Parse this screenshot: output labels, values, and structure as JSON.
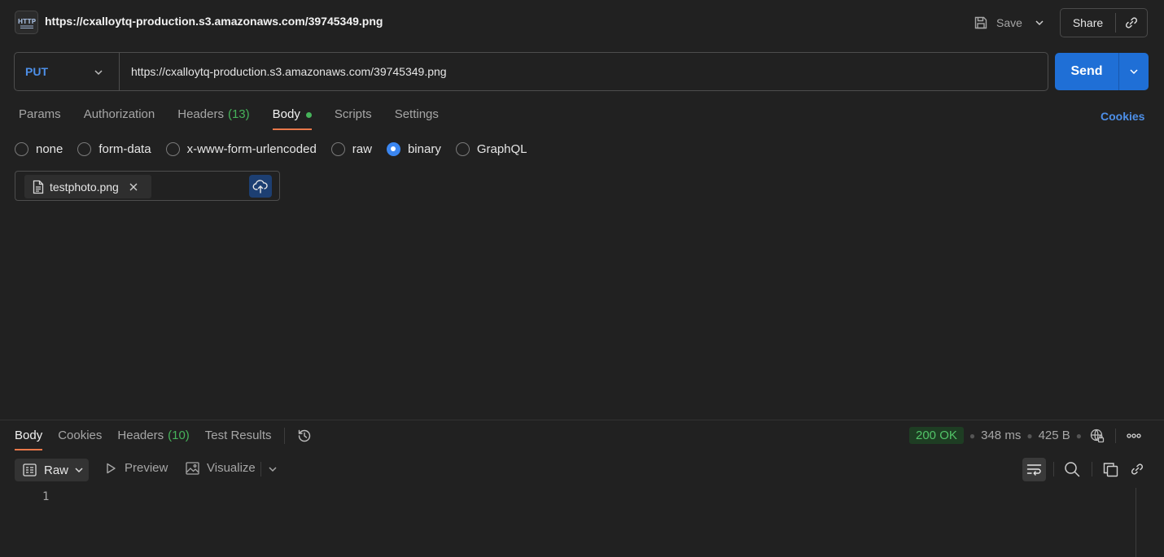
{
  "header": {
    "protocol_icon": "http-icon",
    "title": "https://cxalloytq-production.s3.amazonaws.com/39745349.png",
    "save_label": "Save",
    "share_label": "Share"
  },
  "request": {
    "method": "PUT",
    "url": "https://cxalloytq-production.s3.amazonaws.com/39745349.png",
    "send_label": "Send"
  },
  "request_tabs": [
    {
      "label": "Params",
      "count": "",
      "active": false
    },
    {
      "label": "Authorization",
      "count": "",
      "active": false
    },
    {
      "label": "Headers",
      "count": "(13)",
      "active": false
    },
    {
      "label": "Body",
      "count": "",
      "active": true,
      "dot": true
    },
    {
      "label": "Scripts",
      "count": "",
      "active": false
    },
    {
      "label": "Settings",
      "count": "",
      "active": false
    }
  ],
  "cookies_label": "Cookies",
  "body_types": [
    {
      "label": "none",
      "selected": false
    },
    {
      "label": "form-data",
      "selected": false
    },
    {
      "label": "x-www-form-urlencoded",
      "selected": false
    },
    {
      "label": "raw",
      "selected": false
    },
    {
      "label": "binary",
      "selected": true
    },
    {
      "label": "GraphQL",
      "selected": false
    }
  ],
  "file": {
    "name": "testphoto.png"
  },
  "response": {
    "tabs": [
      {
        "label": "Body",
        "count": "",
        "active": true
      },
      {
        "label": "Cookies",
        "count": "",
        "active": false
      },
      {
        "label": "Headers",
        "count": "(10)",
        "active": false
      },
      {
        "label": "Test Results",
        "count": "",
        "active": false
      }
    ],
    "status": "200 OK",
    "time": "348 ms",
    "size": "425 B",
    "view_mode": "Raw",
    "preview_label": "Preview",
    "visualize_label": "Visualize",
    "line_number": "1"
  },
  "colors": {
    "accent": "#1f6fd6",
    "method": "#4d8fe8",
    "active_tab_underline": "#e8784a",
    "success": "#46b35a"
  }
}
